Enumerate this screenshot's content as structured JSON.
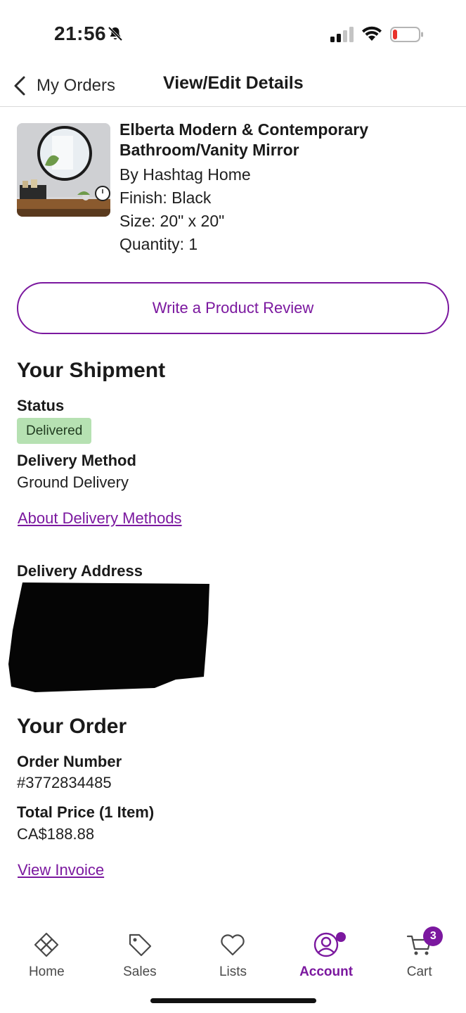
{
  "status_bar": {
    "time": "21:56"
  },
  "nav": {
    "back_label": "My Orders",
    "title": "View/Edit Details"
  },
  "product": {
    "name": "Elberta Modern & Contemporary Bathroom/Vanity Mirror",
    "brand": "By Hashtag Home",
    "finish": "Finish: Black",
    "size": "Size: 20\" x 20\"",
    "quantity": "Quantity: 1"
  },
  "review_button": "Write a Product Review",
  "shipment": {
    "heading": "Your Shipment",
    "status_label": "Status",
    "status_value": "Delivered",
    "delivery_method_label": "Delivery Method",
    "delivery_method_value": "Ground Delivery",
    "about_link": "About Delivery Methods",
    "address_label": "Delivery Address"
  },
  "order": {
    "heading": "Your Order",
    "number_label": "Order Number",
    "number_value": "#3772834485",
    "total_label": "Total Price (1 Item)",
    "total_value": "CA$188.88",
    "invoice_link": "View Invoice"
  },
  "tabs": [
    {
      "label": "Home",
      "icon": "home-icon"
    },
    {
      "label": "Sales",
      "icon": "tag-icon"
    },
    {
      "label": "Lists",
      "icon": "heart-icon"
    },
    {
      "label": "Account",
      "icon": "account-icon",
      "active": true
    },
    {
      "label": "Cart",
      "icon": "cart-icon",
      "badge": "3"
    }
  ],
  "colors": {
    "accent": "#7b189f",
    "status_badge": "#b6e1b2"
  }
}
